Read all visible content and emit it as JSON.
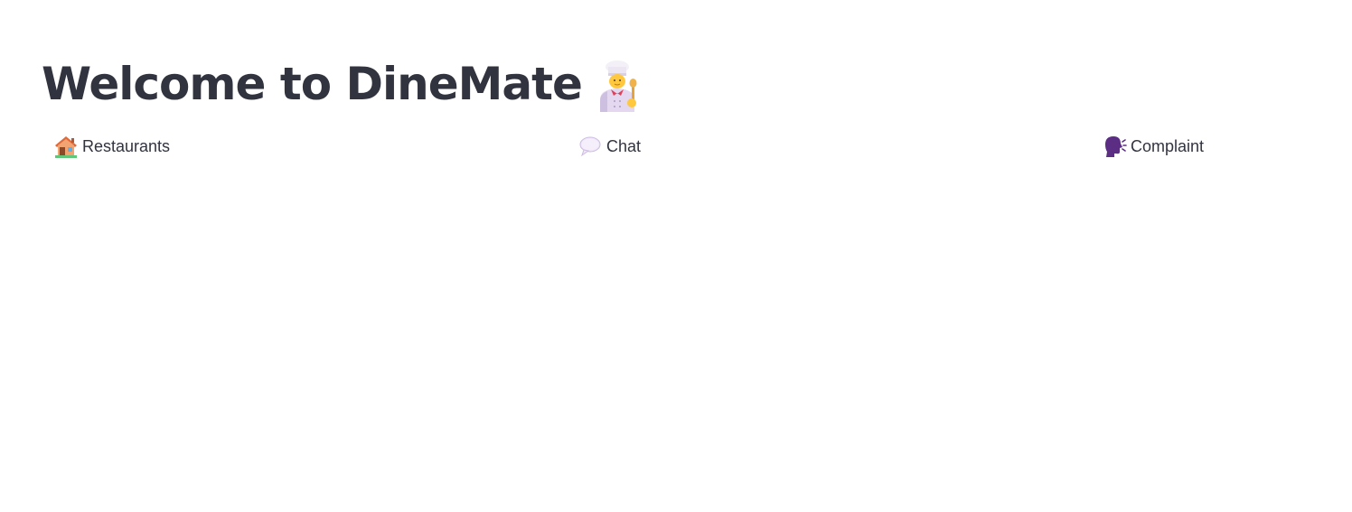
{
  "header": {
    "title": "Welcome to DineMate",
    "title_icon": "cook-icon"
  },
  "nav": {
    "items": [
      {
        "label": "Restaurants",
        "icon": "house-icon"
      },
      {
        "label": "Chat",
        "icon": "speech-bubble-icon"
      },
      {
        "label": "Complaint",
        "icon": "speaking-head-icon"
      }
    ]
  },
  "colors": {
    "text": "#31333f",
    "background": "#ffffff"
  }
}
